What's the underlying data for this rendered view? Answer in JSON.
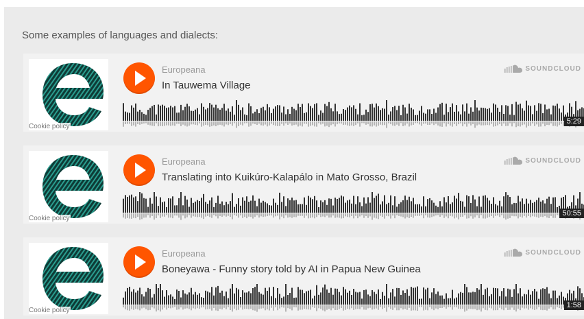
{
  "intro_text": "Some examples of languages and dialects:",
  "brand": {
    "soundcloud_label": "SOUNDCLOUD",
    "accent_color": "#ff5500"
  },
  "players": [
    {
      "uploader": "Europeana",
      "title": "In Tauwema Village",
      "duration": "5:29",
      "cookie_label": "Cookie policy",
      "artwork_icon": "europeana-logo-icon",
      "play_icon": "play-icon"
    },
    {
      "uploader": "Europeana",
      "title": "Translating into Kuikúro-Kalapálo in Mato Grosso, Brazil",
      "duration": "50:55",
      "cookie_label": "Cookie policy",
      "artwork_icon": "europeana-logo-icon",
      "play_icon": "play-icon"
    },
    {
      "uploader": "Europeana",
      "title": "Boneyawa - Funny story told by AI in Papua New Guinea",
      "duration": "1:58",
      "cookie_label": "Cookie policy",
      "artwork_icon": "europeana-logo-icon",
      "play_icon": "play-icon"
    }
  ]
}
